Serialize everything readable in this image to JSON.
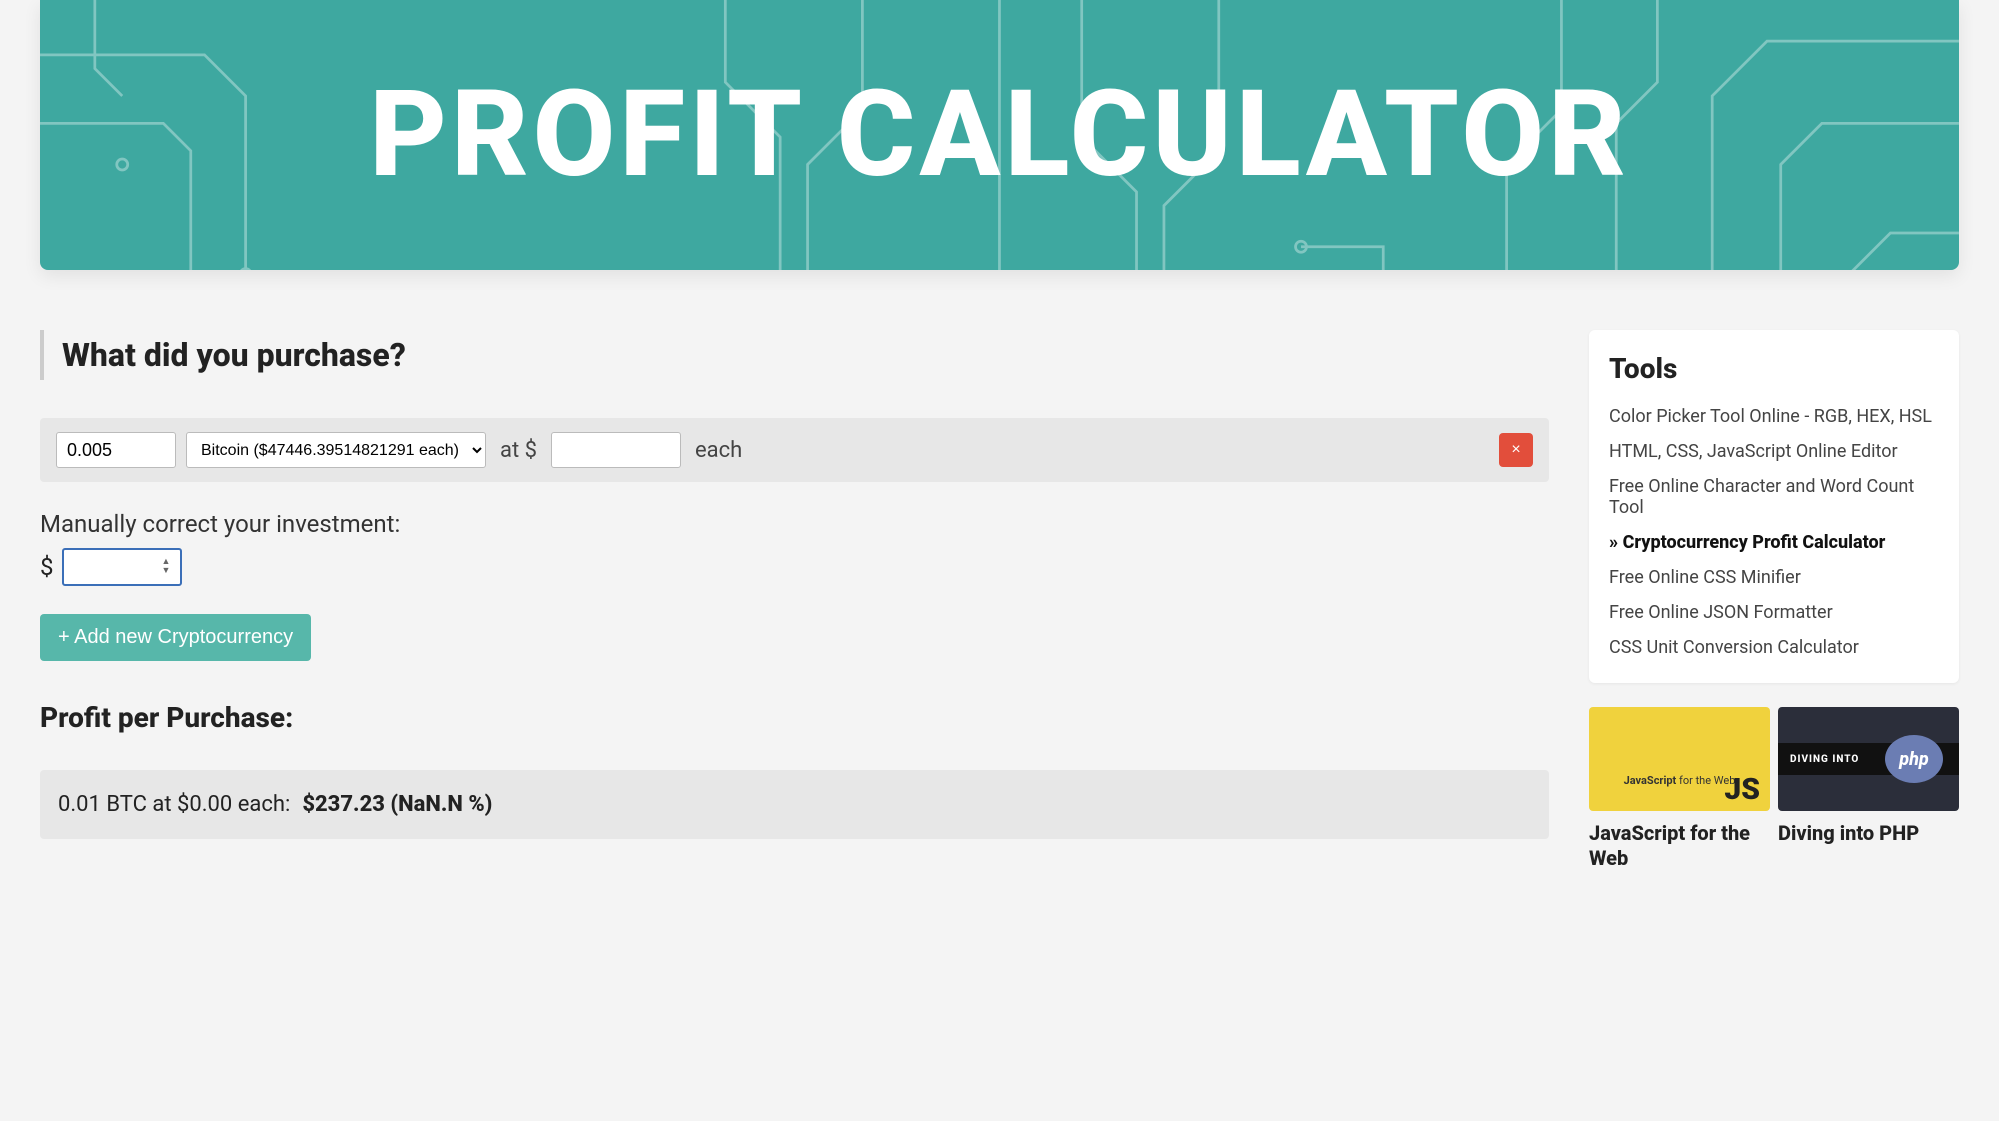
{
  "hero": {
    "title": "PROFIT CALCULATOR"
  },
  "main": {
    "question_heading": "What did you purchase?",
    "row": {
      "qty_value": "0.005",
      "coin_option": "Bitcoin ($47446.39514821291 each)",
      "at_label": "at $",
      "price_value": "",
      "each_label": "each",
      "remove_glyph": "×"
    },
    "manual_label": "Manually correct your investment:",
    "manual_currency": "$",
    "manual_value": "",
    "add_button": "+ Add new Cryptocurrency",
    "profit_heading": "Profit per Purchase:",
    "result": {
      "summary": "0.01 BTC at $0.00 each:",
      "value": "$237.23 (NaN.N %)"
    }
  },
  "sidebar": {
    "tools_title": "Tools",
    "tools": [
      {
        "label": "Color Picker Tool Online - RGB, HEX, HSL",
        "active": false
      },
      {
        "label": "HTML, CSS, JavaScript Online Editor",
        "active": false
      },
      {
        "label": "Free Online Character and Word Count Tool",
        "active": false
      },
      {
        "label": "»  Cryptocurrency Profit Calculator",
        "active": true
      },
      {
        "label": "Free Online CSS Minifier",
        "active": false
      },
      {
        "label": "Free Online JSON Formatter",
        "active": false
      },
      {
        "label": "CSS Unit Conversion Calculator",
        "active": false
      }
    ],
    "courses": [
      {
        "title": "JavaScript for the Web",
        "thumb_kind": "js",
        "thumb_small_pre": "JavaScript",
        "thumb_small_post": " for the Web",
        "thumb_big": "JS"
      },
      {
        "title": "Diving into PHP",
        "thumb_kind": "php",
        "thumb_band": "DIVING INTO",
        "thumb_badge": "php"
      }
    ]
  }
}
